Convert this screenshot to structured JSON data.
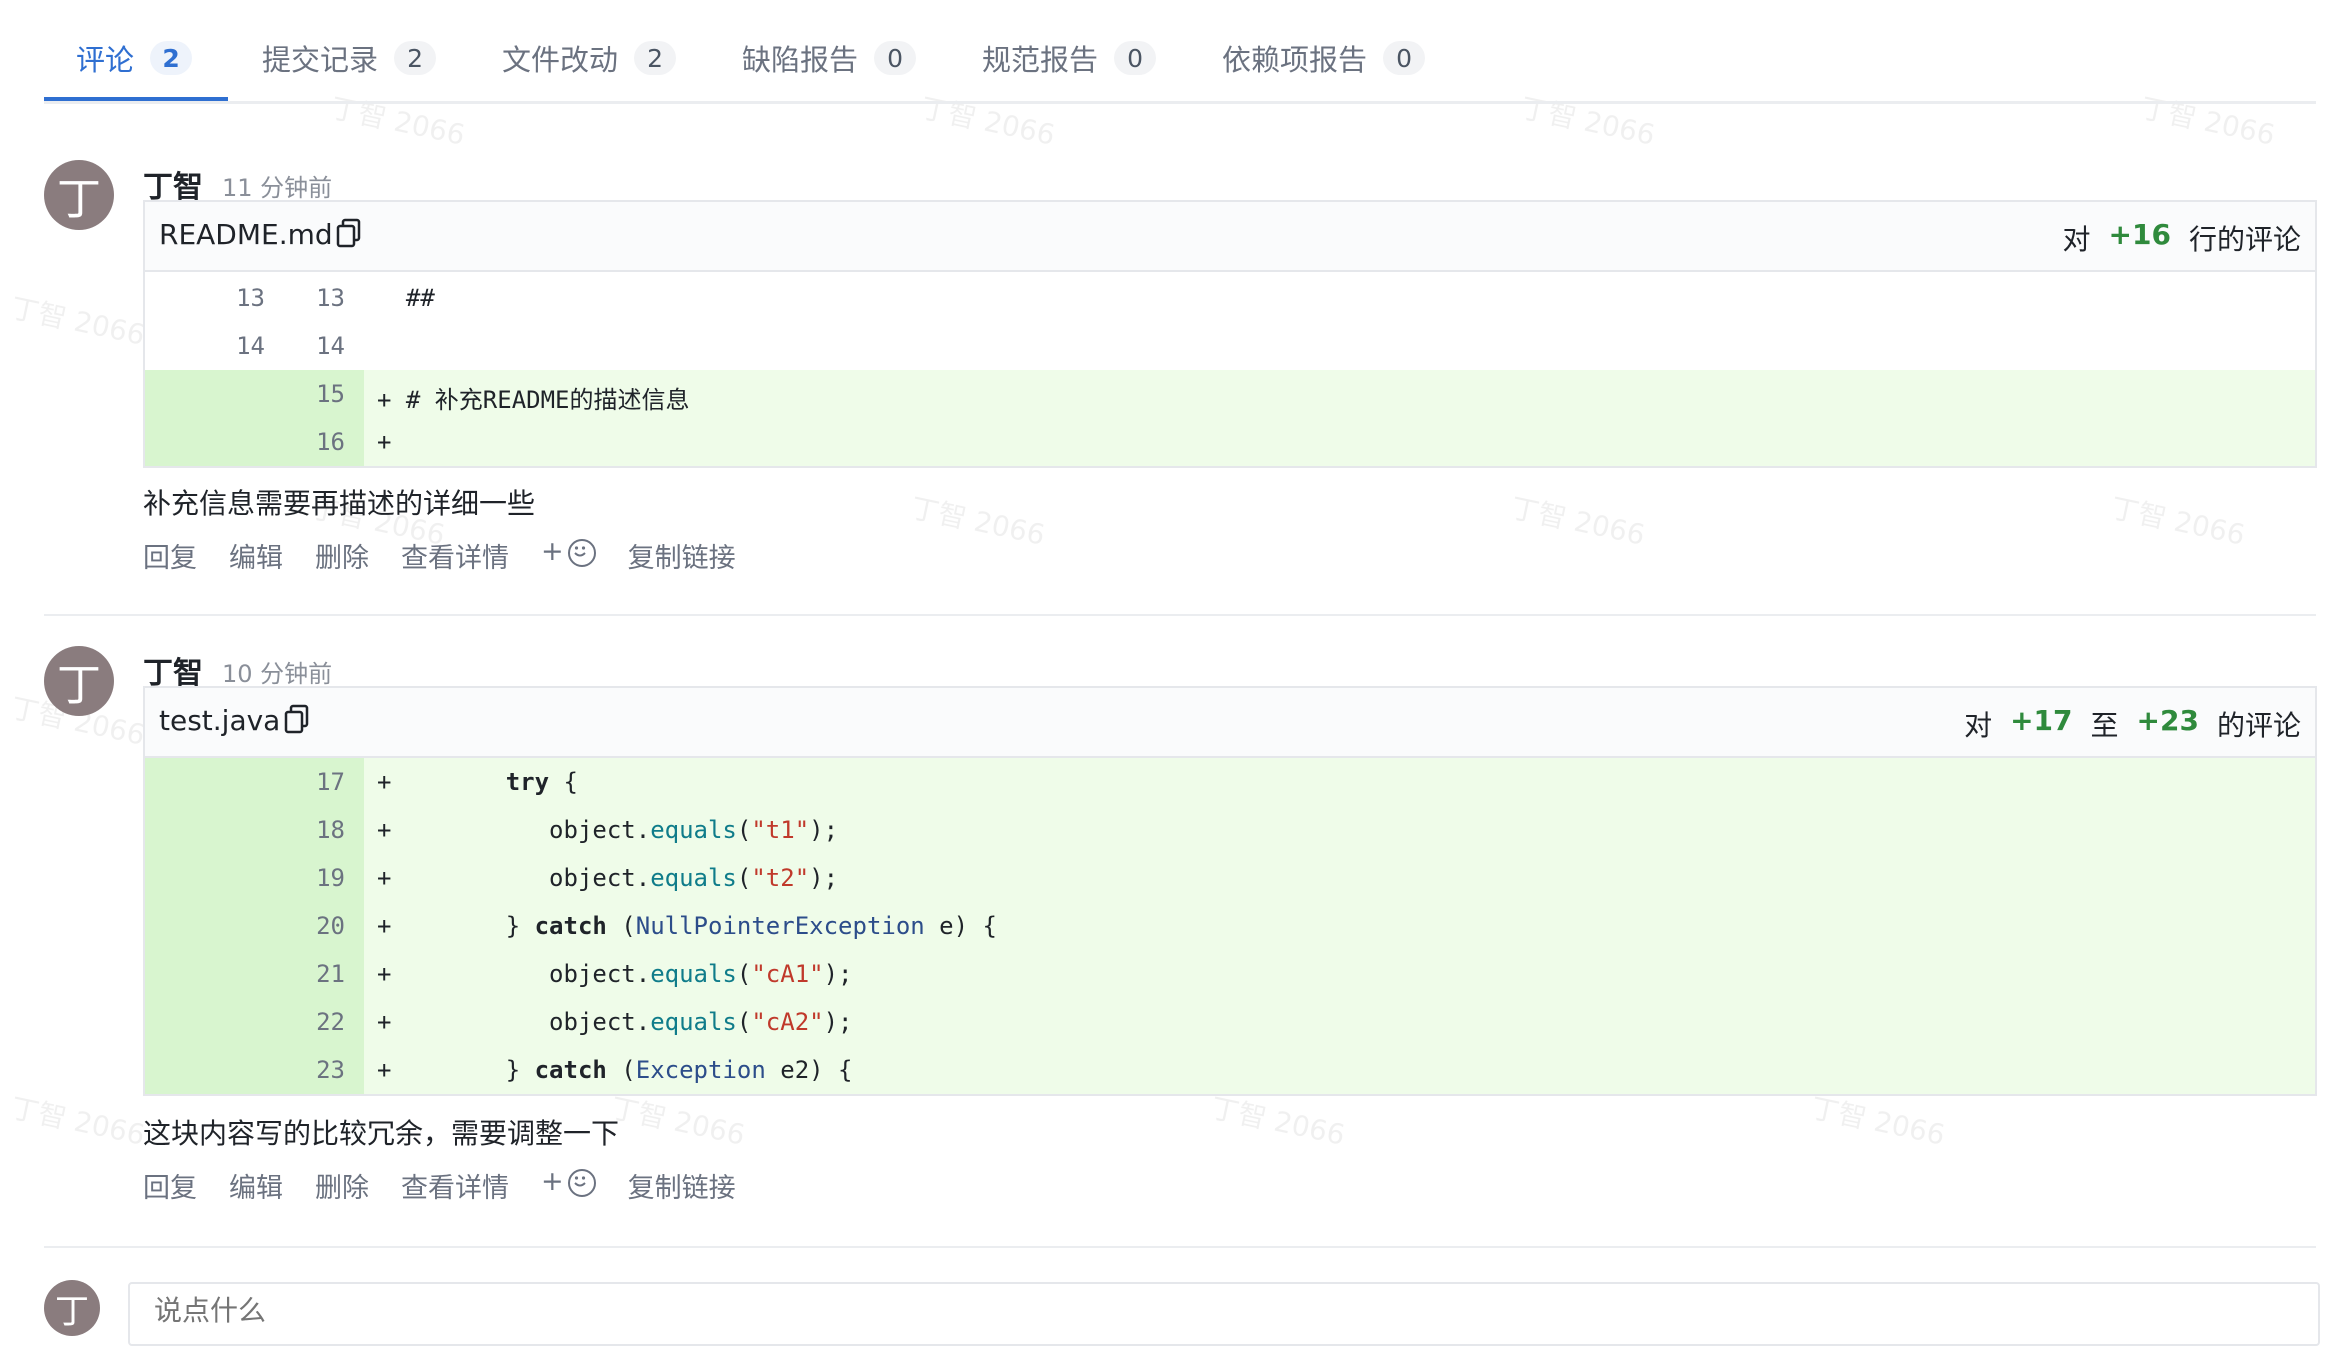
{
  "tabs": [
    {
      "label": "评论",
      "count": "2"
    },
    {
      "label": "提交记录",
      "count": "2"
    },
    {
      "label": "文件改动",
      "count": "2"
    },
    {
      "label": "缺陷报告",
      "count": "0"
    },
    {
      "label": "规范报告",
      "count": "0"
    },
    {
      "label": "依赖项报告",
      "count": "0"
    }
  ],
  "watermark": "丁智 2066",
  "comments": [
    {
      "avatar": "丁",
      "author": "丁智",
      "time": "11 分钟前",
      "file": "README.md",
      "range_prefix": "对",
      "range_from": "+16",
      "range_suffix": "行的评论",
      "lines": [
        {
          "old": "13",
          "new": "13",
          "code": "  ##"
        },
        {
          "old": "14",
          "new": "14",
          "code": ""
        },
        {
          "old": "",
          "new": "15",
          "code": "+ # 补充README的描述信息"
        },
        {
          "old": "",
          "new": "16",
          "code": "+"
        }
      ],
      "text": "补充信息需要再描述的详细一些"
    },
    {
      "avatar": "丁",
      "author": "丁智",
      "time": "10 分钟前",
      "file": "test.java",
      "range_prefix": "对",
      "range_from": "+17",
      "range_mid": "至",
      "range_to": "+23",
      "range_suffix": "的评论",
      "lines": [
        {
          "new": "17",
          "plus": "+",
          "code": "        try {"
        },
        {
          "new": "18",
          "plus": "+",
          "code": "            object.equals(\"t1\");"
        },
        {
          "new": "19",
          "plus": "+",
          "code": "            object.equals(\"t2\");"
        },
        {
          "new": "20",
          "plus": "+",
          "code": "        } catch (NullPointerException e) {"
        },
        {
          "new": "21",
          "plus": "+",
          "code": "            object.equals(\"cA1\");"
        },
        {
          "new": "22",
          "plus": "+",
          "code": "            object.equals(\"cA2\");"
        },
        {
          "new": "23",
          "plus": "+",
          "code": "        } catch (Exception e2) {"
        }
      ],
      "text": "这块内容写的比较冗余，需要调整一下"
    }
  ],
  "actions": {
    "reply": "回复",
    "edit": "编辑",
    "delete": "删除",
    "details": "查看详情",
    "react": "+",
    "copy_link": "复制链接"
  },
  "composer": {
    "avatar": "丁",
    "placeholder": "说点什么"
  }
}
